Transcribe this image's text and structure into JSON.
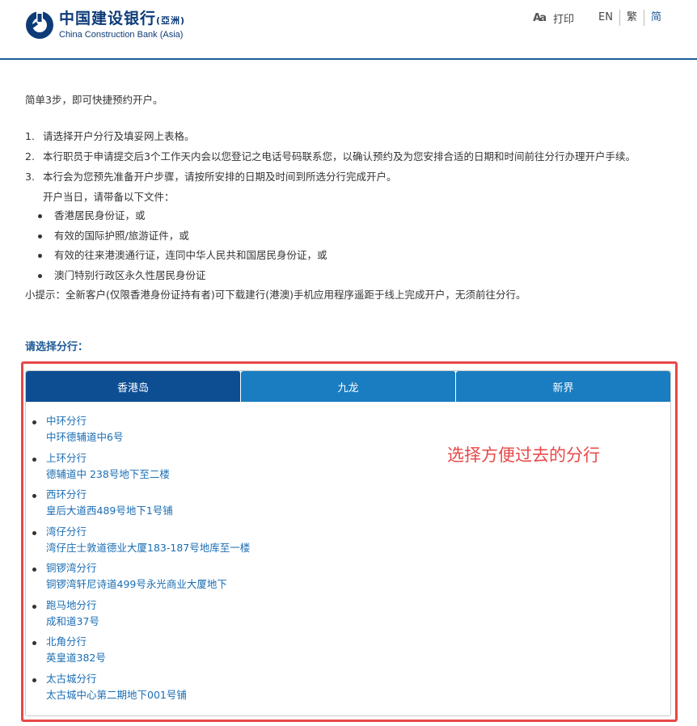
{
  "header": {
    "logo_cn": "中国建设银行",
    "logo_cn_suffix": "(亞洲)",
    "logo_en": "China Construction Bank (Asia)",
    "print_label": "打印",
    "languages": [
      {
        "label": "EN",
        "active": false
      },
      {
        "label": "繁",
        "active": false
      },
      {
        "label": "简",
        "active": true
      }
    ]
  },
  "content": {
    "intro": "简单3步，即可快捷预约开户。",
    "steps": [
      {
        "num": "1.",
        "text": "请选择开户分行及填妥网上表格。"
      },
      {
        "num": "2.",
        "text": "本行职员于申请提交后3个工作天内会以您登记之电话号码联系您，以确认预约及为您安排合适的日期和时间前往分行办理开户手续。"
      },
      {
        "num": "3.",
        "text": "本行会为您预先准备开户步骤，请按所安排的日期及时间到所选分行完成开户。"
      }
    ],
    "docs_intro": "开户当日，请带备以下文件：",
    "docs": [
      "香港居民身份证，或",
      "有效的国际护照/旅游证件，或",
      "有效的往来港澳通行证，连同中华人民共和国居民身份证，或",
      "澳门特别行政区永久性居民身份证"
    ],
    "tip": "小提示：全新客户(仅限香港身份证持有者)可下载建行(港澳)手机应用程序遥距于线上完成开户，无须前往分行。"
  },
  "choose_label": "请选择分行：",
  "tabs": [
    {
      "label": "香港岛",
      "active": true
    },
    {
      "label": "九龙",
      "active": false
    },
    {
      "label": "新界",
      "active": false
    }
  ],
  "branches": [
    {
      "name": "中环分行",
      "address": "中环德辅道中6号"
    },
    {
      "name": "上环分行",
      "address": "德辅道中 238号地下至二楼"
    },
    {
      "name": "西环分行",
      "address": "皇后大道西489号地下1号铺"
    },
    {
      "name": "湾仔分行",
      "address": "湾仔庄士敦道德业大厦183-187号地库至一楼"
    },
    {
      "name": "铜锣湾分行",
      "address": "铜锣湾轩尼诗道499号永光商业大厦地下"
    },
    {
      "name": "跑马地分行",
      "address": "成和道37号"
    },
    {
      "name": "北角分行",
      "address": "英皇道382号"
    },
    {
      "name": "太古城分行",
      "address": "太古城中心第二期地下001号铺"
    }
  ],
  "annotation": "选择方便过去的分行",
  "colors": {
    "brand": "#0d3b78",
    "tab_active": "#0d4e93",
    "tab": "#1a7dc1",
    "link": "#1a6db3",
    "highlight": "#e84848"
  }
}
